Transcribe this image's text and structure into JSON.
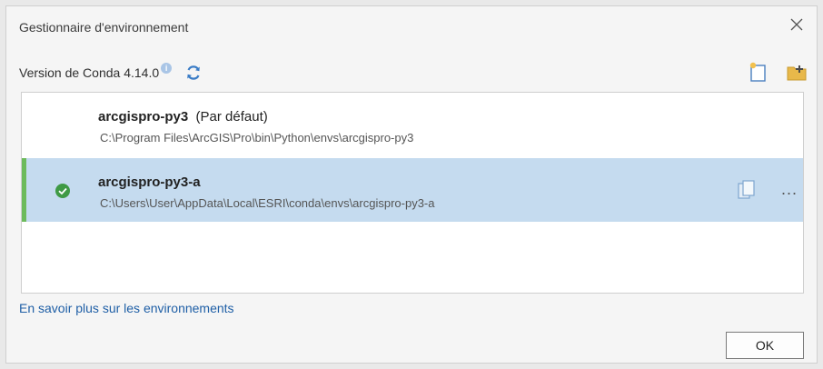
{
  "dialog": {
    "title": "Gestionnaire d'environnement",
    "conda_version": "Version de Conda 4.14.0",
    "info_glyph": "i"
  },
  "environments": [
    {
      "name": "arcgispro-py3",
      "tag": "(Par défaut)",
      "path": "C:\\Program Files\\ArcGIS\\Pro\\bin\\Python\\envs\\arcgispro-py3",
      "active": false
    },
    {
      "name": "arcgispro-py3-a",
      "tag": "",
      "path": "C:\\Users\\User\\AppData\\Local\\ESRI\\conda\\envs\\arcgispro-py3-a",
      "active": true
    }
  ],
  "more_glyph": "...",
  "link_text": "En savoir plus sur les environnements",
  "ok_label": "OK",
  "colors": {
    "selected_row": "#c5dbef",
    "active_accent": "#6dbb5c",
    "link": "#1f5fa6",
    "refresh": "#3a7cc6"
  }
}
